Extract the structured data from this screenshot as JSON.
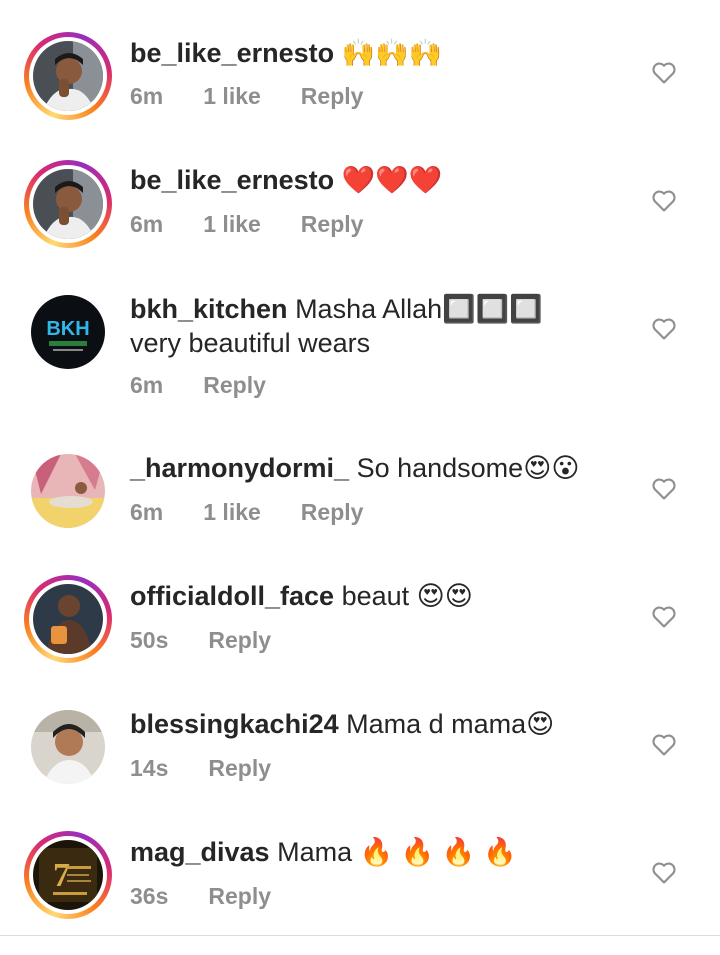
{
  "comments": [
    {
      "username": "be_like_ernesto",
      "text": "🙌🙌🙌",
      "time": "6m",
      "likes": "1 like",
      "reply": "Reply",
      "ring": true
    },
    {
      "username": "be_like_ernesto",
      "text": "❤️❤️❤️",
      "time": "6m",
      "likes": "1 like",
      "reply": "Reply",
      "ring": true
    },
    {
      "username": "bkh_kitchen",
      "text": "Masha Allah🔲🔲🔲 very beautiful wears",
      "time": "6m",
      "likes": "",
      "reply": "Reply",
      "ring": false
    },
    {
      "username": "_harmonydormi_",
      "text": "So handsome😍😮",
      "time": "6m",
      "likes": "1 like",
      "reply": "Reply",
      "ring": false
    },
    {
      "username": "officialdoll_face",
      "text": "beaut 😍😍",
      "time": "50s",
      "likes": "",
      "reply": "Reply",
      "ring": true
    },
    {
      "username": "blessingkachi24",
      "text": "Mama d mama😍",
      "time": "14s",
      "likes": "",
      "reply": "Reply",
      "ring": false
    },
    {
      "username": "mag_divas",
      "text": "Mama 🔥 🔥 🔥 🔥",
      "time": "36s",
      "likes": "",
      "reply": "Reply",
      "ring": true
    }
  ],
  "icons": {
    "like": "heart-outline-icon"
  },
  "colors": {
    "meta": "#8e8e8e",
    "text": "#262626",
    "divider": "#dbdbdb"
  }
}
